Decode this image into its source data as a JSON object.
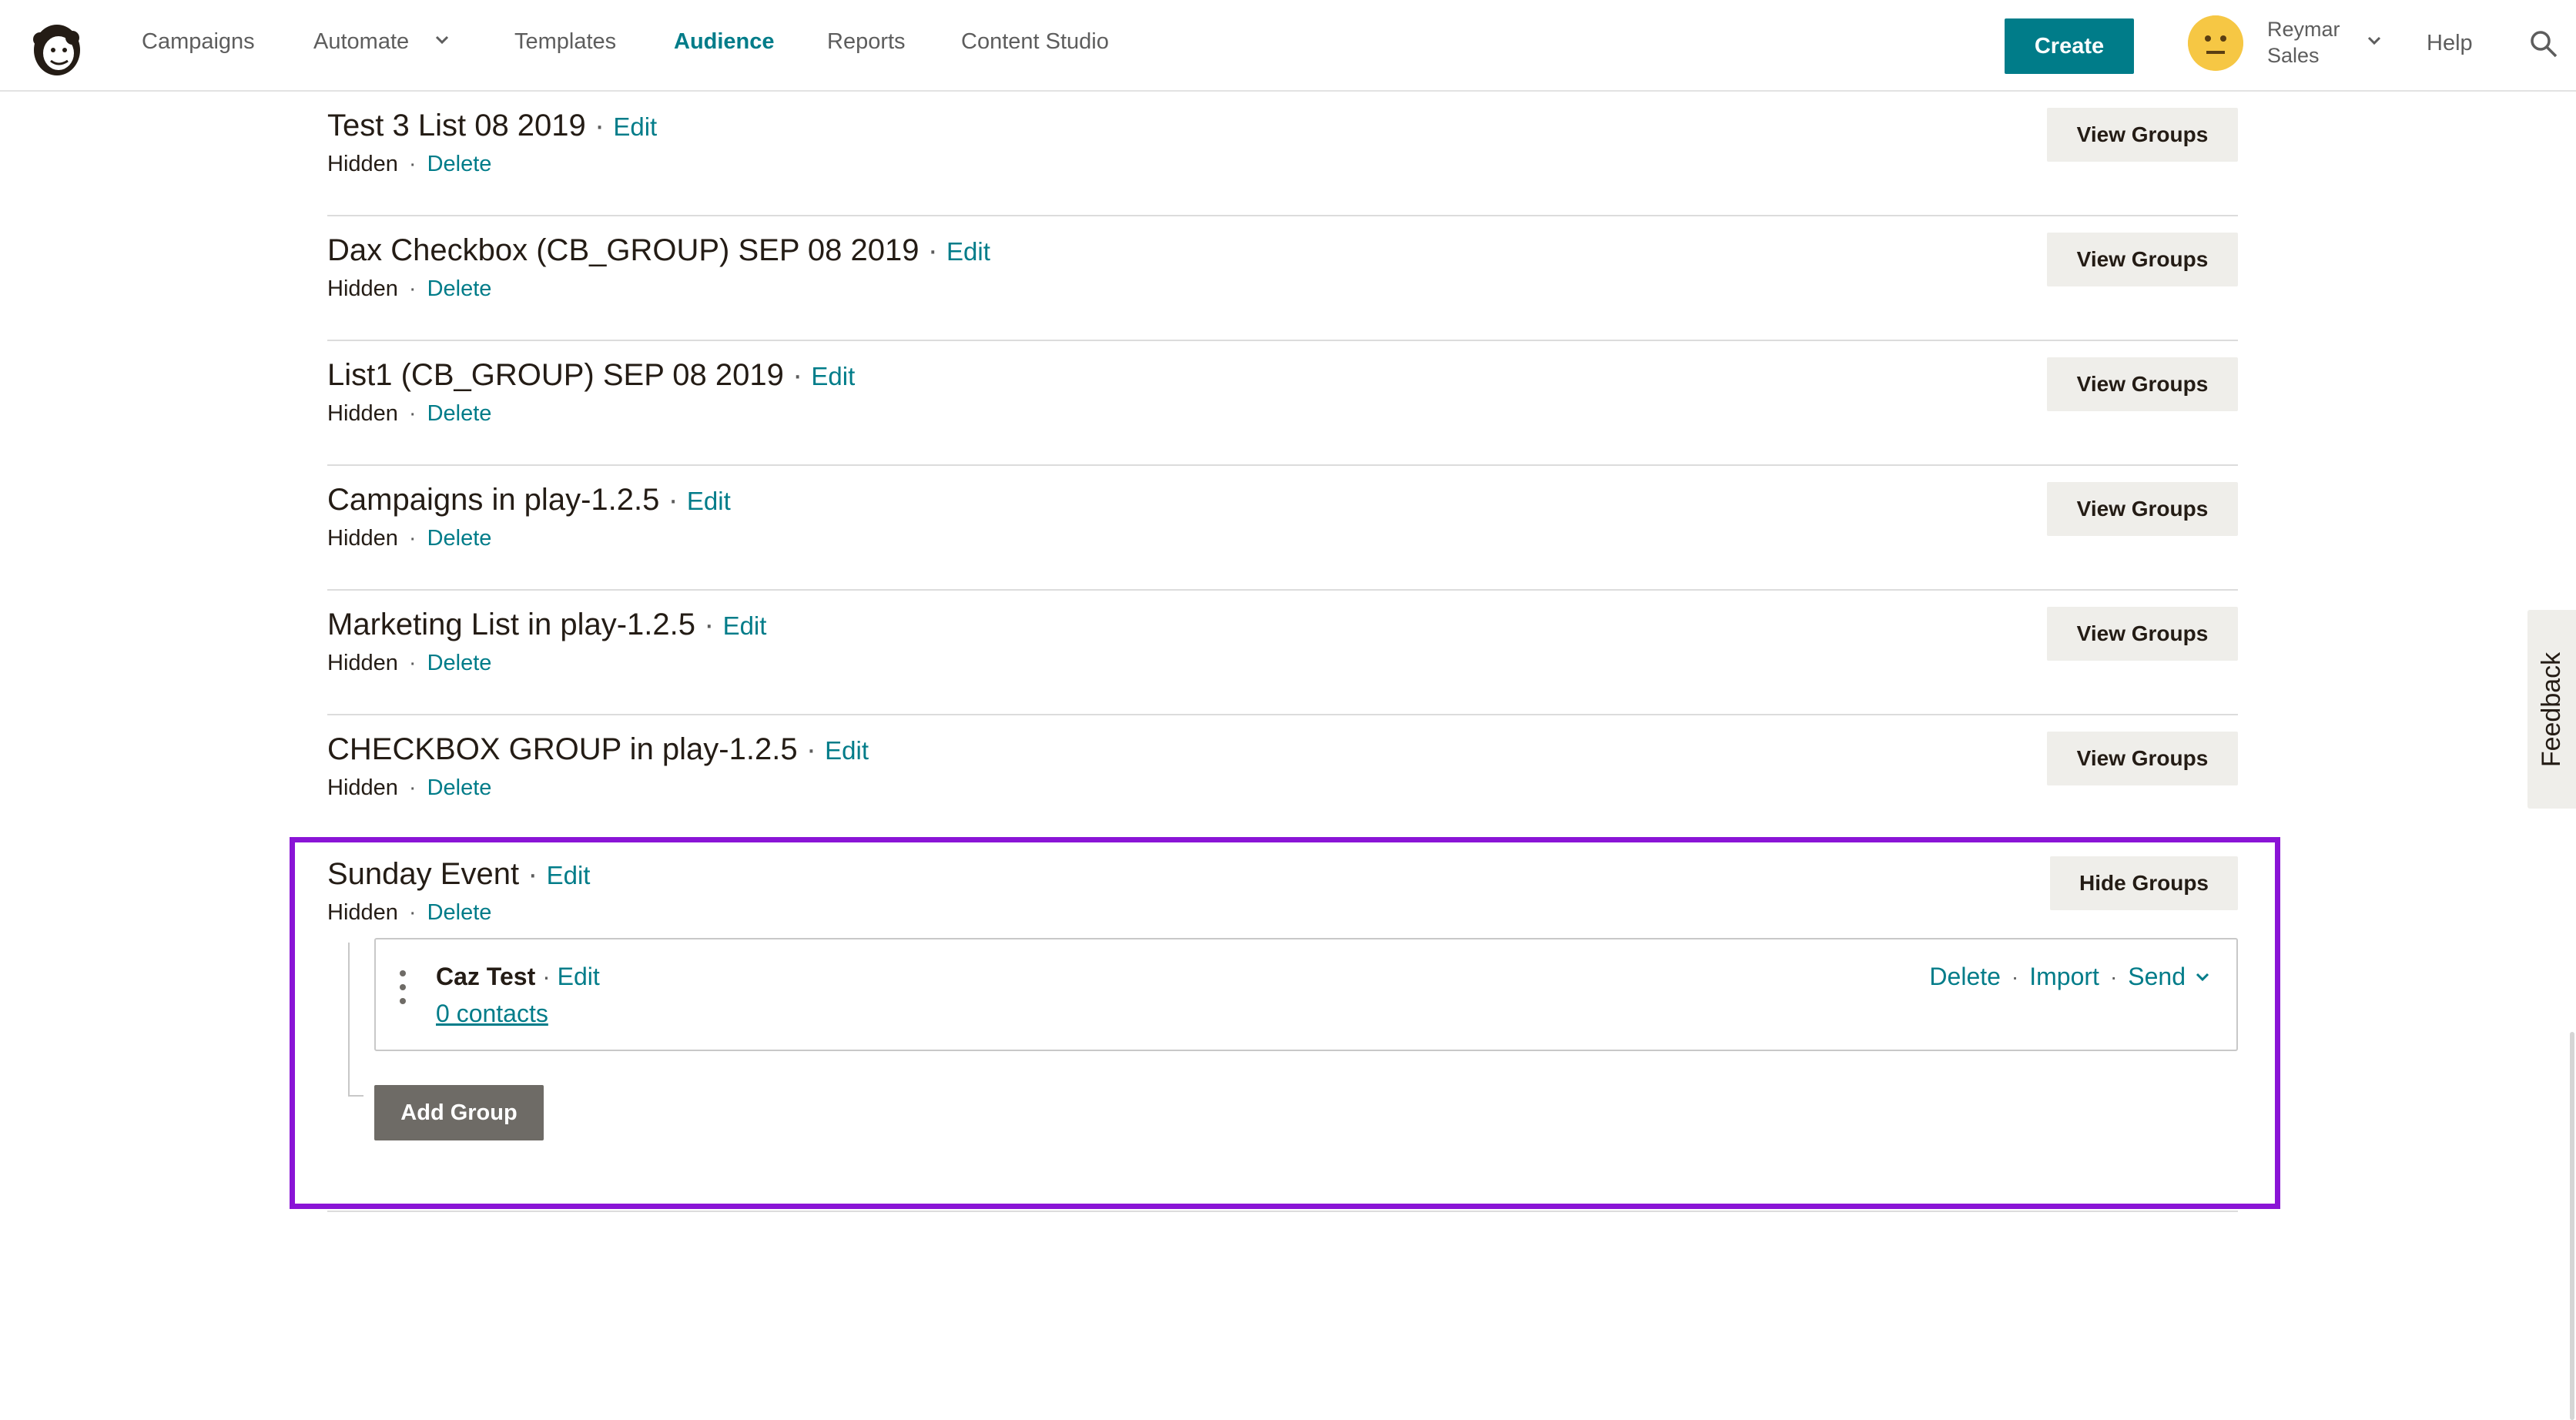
{
  "nav": {
    "items": [
      "Campaigns",
      "Automate",
      "Templates",
      "Audience",
      "Reports",
      "Content Studio"
    ],
    "active": "Audience",
    "create_label": "Create",
    "user_name_line1": "Reymar",
    "user_name_line2": "Sales",
    "help_label": "Help"
  },
  "rows": [
    {
      "title": "Test 3 List 08 2019",
      "edit": "Edit",
      "status": "Hidden",
      "delete": "Delete",
      "button": "View Groups"
    },
    {
      "title": "Dax Checkbox (CB_GROUP) SEP 08 2019",
      "edit": "Edit",
      "status": "Hidden",
      "delete": "Delete",
      "button": "View Groups"
    },
    {
      "title": "List1 (CB_GROUP) SEP 08 2019",
      "edit": "Edit",
      "status": "Hidden",
      "delete": "Delete",
      "button": "View Groups"
    },
    {
      "title": "Campaigns in play-1.2.5",
      "edit": "Edit",
      "status": "Hidden",
      "delete": "Delete",
      "button": "View Groups"
    },
    {
      "title": "Marketing List in play-1.2.5",
      "edit": "Edit",
      "status": "Hidden",
      "delete": "Delete",
      "button": "View Groups"
    },
    {
      "title": "CHECKBOX GROUP in play-1.2.5",
      "edit": "Edit",
      "status": "Hidden",
      "delete": "Delete",
      "button": "View Groups"
    }
  ],
  "expanded": {
    "title": "Sunday Event",
    "edit": "Edit",
    "status": "Hidden",
    "delete": "Delete",
    "button": "Hide Groups",
    "group": {
      "name": "Caz Test",
      "edit": "Edit",
      "contacts": "0 contacts",
      "delete": "Delete",
      "import": "Import",
      "send": "Send"
    },
    "add_group_label": "Add Group"
  },
  "feedback_label": "Feedback",
  "colors": {
    "accent": "#007c89",
    "highlight": "#8a14d6",
    "button_bg": "#efeeea",
    "add_group_bg": "#6e6b66"
  }
}
